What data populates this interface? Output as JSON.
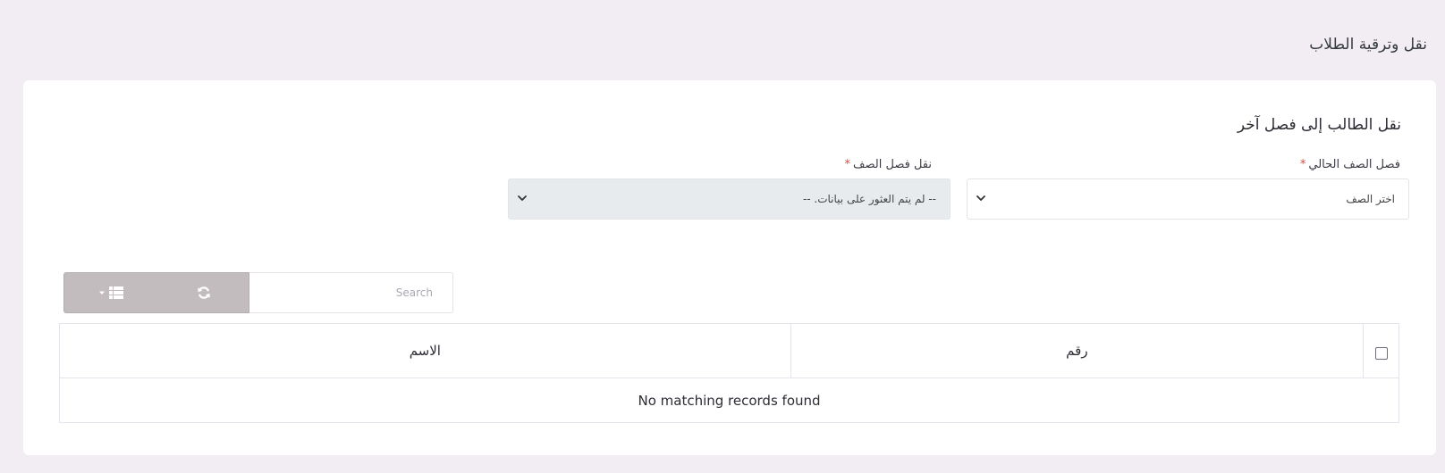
{
  "page": {
    "title": "نقل وترقية الطلاب"
  },
  "card": {
    "title": "نقل الطالب إلى فصل آخر"
  },
  "form": {
    "current_class": {
      "label": "فصل الصف الحالي",
      "required_mark": "*",
      "value": "اختر الصف",
      "chevron_icon": "chevron-down-icon"
    },
    "target_class": {
      "label": "نقل فصل الصف",
      "required_mark": "*",
      "value": "-- لم يتم العثور على بيانات. --",
      "chevron_icon": "chevron-down-icon",
      "disabled": true
    }
  },
  "toolbar": {
    "search_placeholder": "Search",
    "refresh_icon": "refresh-icon",
    "columns_icon": "list-icon",
    "dropdown_caret_icon": "caret-down-icon"
  },
  "table": {
    "columns": [
      "",
      "رقم",
      "الاسم"
    ],
    "empty_message": "No matching records found"
  },
  "colors": {
    "page_background": "#f1edf3",
    "card_background": "#ffffff",
    "required": "#e0493b",
    "toolbar_button": "#c2bcbf",
    "disabled_select": "#e8ebee"
  }
}
